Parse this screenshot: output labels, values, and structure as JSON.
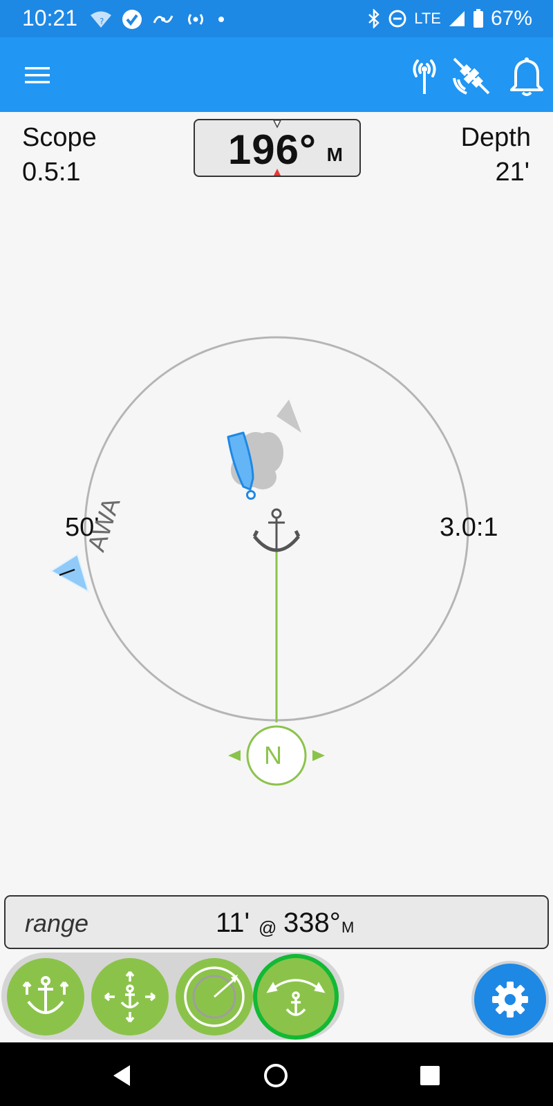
{
  "status_bar": {
    "time": "10:21",
    "network": "LTE",
    "battery": "67%",
    "icons": [
      "wifi-unknown-icon",
      "check-circle-icon",
      "gesture-icon",
      "hotspot-icon",
      "dot-icon",
      "bluetooth-icon",
      "do-not-disturb-icon",
      "signal-icon",
      "battery-icon"
    ]
  },
  "app_bar": {
    "icons": [
      "menu-icon",
      "antenna-icon",
      "satellite-off-icon",
      "bell-icon"
    ]
  },
  "readouts": {
    "scope_label": "Scope",
    "scope_value": "0.5:1",
    "depth_label": "Depth",
    "depth_value": "21'",
    "heading_value": "196°",
    "heading_unit": "M"
  },
  "map": {
    "radius_label": "50'",
    "ratio_label": "3.0:1",
    "awa_label": "AWA",
    "north_label": "N",
    "colors": {
      "ring": "#b5b5b5",
      "rode": "#8bc34a",
      "boat": "#64b5f6",
      "boat_outline": "#1e88e5",
      "anchor": "#555555",
      "awa_marker": "#90caf9"
    }
  },
  "range": {
    "label": "range",
    "distance": "11'",
    "at": "@",
    "bearing": "338°",
    "unit": "M"
  },
  "toolbar": {
    "buttons": [
      {
        "icon": "anchor-expand-icon",
        "active": false
      },
      {
        "icon": "anchor-move-icon",
        "active": false
      },
      {
        "icon": "radius-icon",
        "active": false
      },
      {
        "icon": "anchor-rotate-icon",
        "active": true
      }
    ],
    "settings_icon": "gear-icon",
    "colors": {
      "button": "#8bc34a",
      "active_ring": "#12b935",
      "settings": "#1e88e5"
    }
  },
  "nav_bar": {
    "icons": [
      "back-icon",
      "home-icon",
      "recents-icon"
    ]
  }
}
